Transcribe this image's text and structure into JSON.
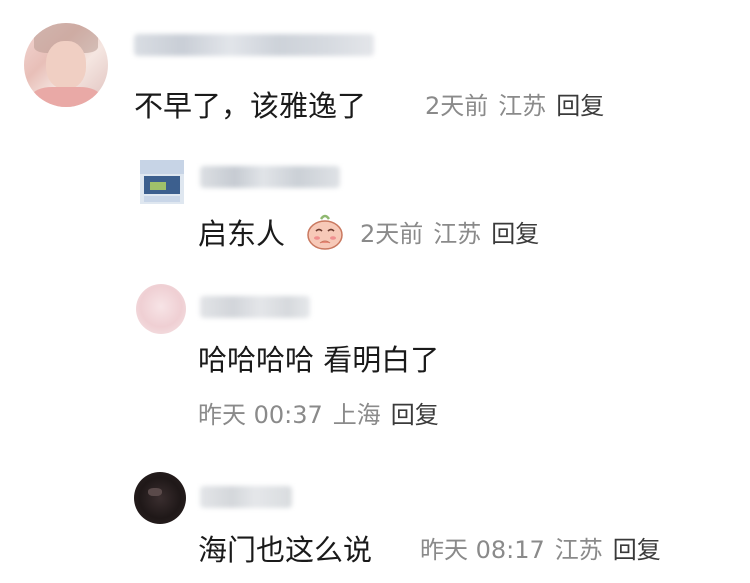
{
  "comments": [
    {
      "text": "不早了，该雅逸了",
      "time": "2天前",
      "location": "江苏",
      "reply_label": "回复"
    },
    {
      "text": "启东人",
      "emoji": "shy-pleading-emoji",
      "time": "2天前",
      "location": "江苏",
      "reply_label": "回复"
    },
    {
      "text": "哈哈哈哈 看明白了",
      "time": "昨天 00:37",
      "location": "上海",
      "reply_label": "回复"
    },
    {
      "text": "海门也这么说",
      "time": "昨天 08:17",
      "location": "江苏",
      "reply_label": "回复"
    }
  ],
  "colors": {
    "comment_text": "#1a1a1a",
    "meta_text": "#8a8a8a",
    "reply_text": "#3a3a3a",
    "background": "#ffffff"
  }
}
